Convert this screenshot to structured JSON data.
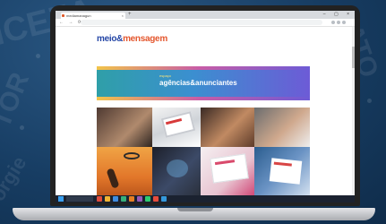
{
  "browser": {
    "tab_title": "mediamanagun",
    "tab_close": "×",
    "new_tab": "+",
    "window_controls": "– ▢ ×",
    "nav_glyphs": "← → ⟳",
    "url": ""
  },
  "site": {
    "logo_main": "meio&",
    "logo_accent": "mensagem",
    "menu": [
      "",
      "",
      "",
      "",
      "",
      "",
      "",
      "",
      "",
      "",
      "",
      "",
      "",
      ""
    ],
    "banner_small": "espaço",
    "banner_title": "agências&anunciantes"
  },
  "taskbar": {
    "tray_text": ""
  },
  "colors": {
    "logo": "#2446a6",
    "logo_accent": "#e4572e",
    "banner_start": "#2f9fa8",
    "banner_end": "#6d5bd6",
    "taskbar": "#1b2230"
  },
  "taskbar_icon_colors": [
    "#e04b3b",
    "#f1b533",
    "#3f8de0",
    "#36b07a",
    "#e67e22",
    "#9b59b6",
    "#2ecc71",
    "#e74c3c",
    "#3498db"
  ]
}
